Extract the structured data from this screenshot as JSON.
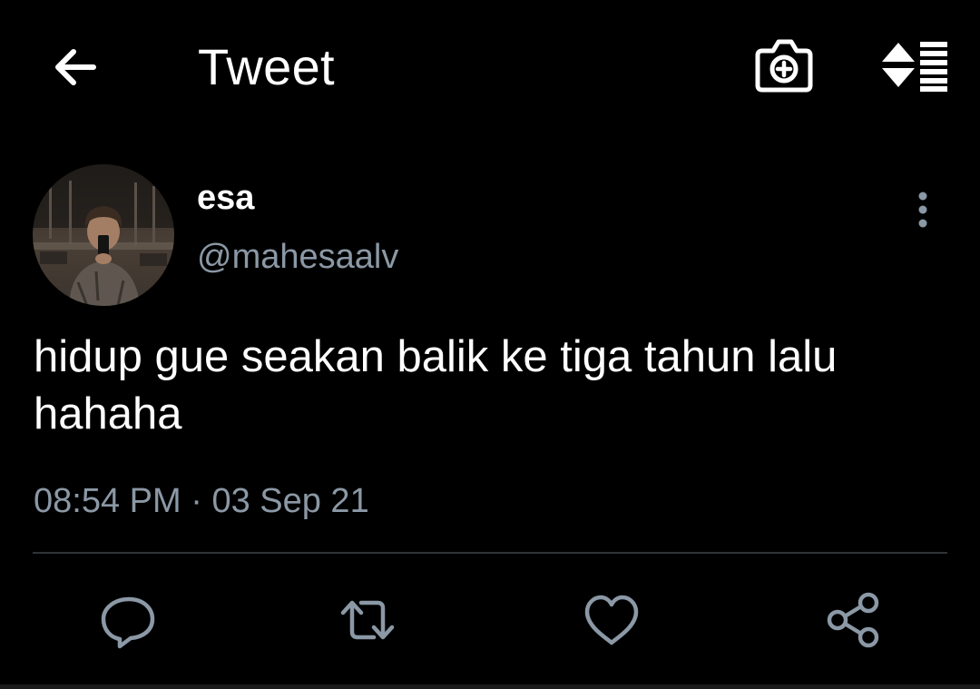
{
  "header": {
    "title": "Tweet",
    "back_icon": "arrow-left-icon",
    "camera_icon": "camera-add-icon",
    "sort_icon": "sort-arrows-list-icon"
  },
  "tweet": {
    "author": {
      "name": "esa",
      "handle": "@mahesaalv"
    },
    "text_lines": [
      "hidup gue seakan balik ke tiga tahun lalu",
      "hahaha"
    ],
    "time": "08:54 PM",
    "separator": "·",
    "date": "03 Sep 21"
  },
  "actions": [
    {
      "icon": "reply-icon"
    },
    {
      "icon": "retweet-icon"
    },
    {
      "icon": "like-heart-icon"
    },
    {
      "icon": "share-icon"
    }
  ],
  "colors": {
    "background": "#000000",
    "primary_text": "#ffffff",
    "secondary_text": "#8b98a5",
    "divider": "#2f3336"
  }
}
